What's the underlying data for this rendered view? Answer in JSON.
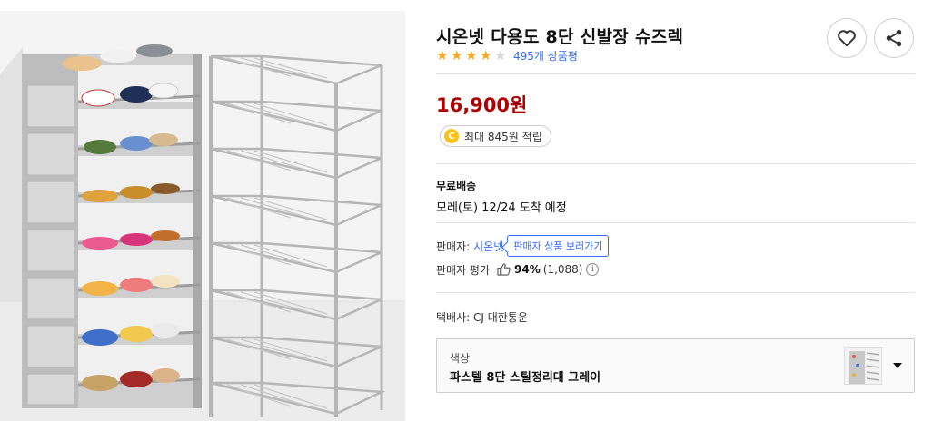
{
  "product": {
    "title": "시온넷 다용도 8단 신발장 슈즈렉",
    "rating_stars": 4,
    "rating_max": 5,
    "review_count": "495개 상품평",
    "price": "16,900원"
  },
  "reward": {
    "coin_label": "C",
    "text": "최대 845원 적립"
  },
  "shipping": {
    "title": "무료배송",
    "arrival": "모레(토) 12/24 도착 예정"
  },
  "seller": {
    "label": "판매자:",
    "name": "시온넷",
    "link_label": "판매자 상품 보러가기",
    "eval_label": "판매자 평가",
    "eval_pct": "94%",
    "eval_count": "(1,088)",
    "info_glyph": "i"
  },
  "courier": "택배사: CJ 대한통운",
  "option": {
    "label": "색상",
    "value": "파스텔 8단 스틸정리대 그레이"
  },
  "icons": {
    "wishlist": "heart-icon",
    "share": "share-icon",
    "seller_eval": "thumbs-up-icon",
    "option_toggle": "caret-down-icon"
  },
  "colors": {
    "price": "#ae0000",
    "link": "#346aff",
    "star": "#f5a623",
    "coin": "#f8c21b"
  }
}
